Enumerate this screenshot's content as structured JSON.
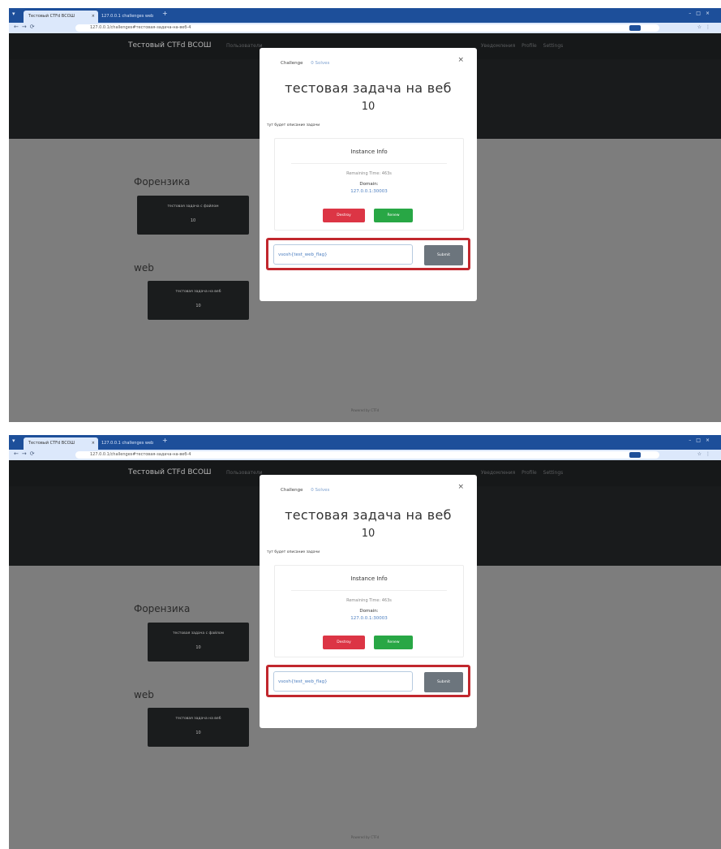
{
  "browser": {
    "active_tab": "Тестовый CTFd ВСОШ",
    "inactive_tab": "127.0.0.1 challenges web",
    "url": "127.0.0.1/challenges#тестовая-задача-на-веб-4"
  },
  "site": {
    "brand": "Тестовый CTFd ВСОШ",
    "nav_left": "Пользователи",
    "nav_right": "Уведомления Profile Settings",
    "footer": "Powered by CTFd"
  },
  "categories": [
    {
      "name": "Форензика",
      "card_title": "тестовая задача с файлом",
      "card_value": "10"
    },
    {
      "name": "web",
      "card_title": "тестовая задача на веб",
      "card_value": "10"
    }
  ],
  "modal": {
    "tab_challenge": "Challenge",
    "tab_solves": "0 Solves",
    "close": "×",
    "title": "тестовая задача на веб",
    "value": "10",
    "description": "тут будет описание задачи",
    "instance": {
      "title": "Instance Info",
      "remaining": "Remaining Time: 463s",
      "domain_label": "Domain:",
      "domain_value": "127.0.0.1:30003",
      "destroy": "Destroy",
      "renew": "Renew"
    },
    "flag_value": "vsosh{test_web_flag}",
    "submit": "Submit"
  },
  "colors": {
    "highlight": "#c1272d",
    "destroy": "#dc3545",
    "renew": "#28a745",
    "submit": "#6c757d"
  }
}
